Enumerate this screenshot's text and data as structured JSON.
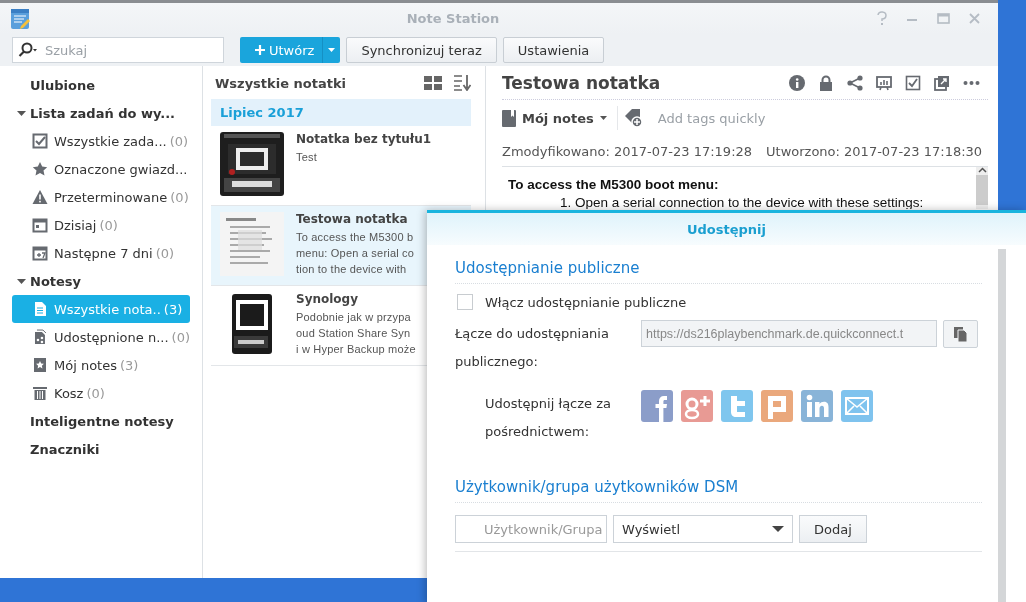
{
  "window": {
    "title": "Note Station"
  },
  "toolbar": {
    "search": {
      "placeholder": "Szukaj"
    },
    "create_button": "Utwórz",
    "buttons": [
      "Synchronizuj teraz",
      "Ustawienia"
    ]
  },
  "sidebar": {
    "sections": [
      {
        "label": "Ulubione"
      },
      {
        "label": "Lista zadań do wy...",
        "expanded": true,
        "children": [
          {
            "label": "Wszystkie zada...",
            "count": "(0)",
            "selected": false
          },
          {
            "label": "Oznaczone gwiazd...",
            "selected": false
          },
          {
            "label": "Przeterminowane",
            "count": "(0)",
            "selected": false
          },
          {
            "label": "Dzisiaj",
            "count": "(0)",
            "selected": false
          },
          {
            "label": "Następne 7 dni",
            "count": "(0)",
            "selected": false
          }
        ]
      },
      {
        "label": "Notesy",
        "expanded": true,
        "children": [
          {
            "label": "Wszystkie nota..",
            "count": "(3)",
            "selected": true
          },
          {
            "label": "Udostępnione n...",
            "count": "(0)",
            "selected": false
          },
          {
            "label": "Mój notes",
            "count": "(3)",
            "selected": false
          },
          {
            "label": "Kosz",
            "count": "(0)",
            "selected": false
          }
        ]
      },
      {
        "label": "Inteligentne notesy"
      },
      {
        "label": "Znaczniki"
      }
    ]
  },
  "note_list": {
    "title": "Wszystkie notatki",
    "group": "Lipiec 2017",
    "notes": [
      {
        "title": "Notatka bez tytułu1",
        "preview": [
          "Test"
        ],
        "selected": false
      },
      {
        "title": "Testowa notatka",
        "preview": [
          "To access the M5300 b",
          "menu: Open a serial co",
          "tion to the device with"
        ],
        "selected": true
      },
      {
        "title": "Synology",
        "preview": [
          "Podobnie jak w przypa",
          "oud Station Share Syn",
          "i w Hyper Backup może"
        ],
        "selected": false
      }
    ]
  },
  "detail": {
    "title": "Testowa notatka",
    "notebook": "Mój notes",
    "tags_placeholder": "Add tags quickly",
    "modified": "Zmodyfikowano: 2017-07-23 17:19:28",
    "created": "Utworzono: 2017-07-23 17:18:30",
    "body_heading": "To access the M5300 boot menu:",
    "body_item": "1. Open a serial connection to the device with these settings:"
  },
  "dialog": {
    "title": "Udostępnij",
    "public_section": "Udostępnianie publiczne",
    "enable_public": {
      "label": "Włącz udostępnianie publiczne",
      "checked": false
    },
    "link_label": "Łącze do udostępniania publicznego:",
    "link_value": "https://ds216playbenchmark.de.quickconnect.t",
    "share_label": "Udostępnij łącze za pośrednictwem:",
    "user_section": "Użytkownik/grupa użytkowników DSM",
    "user_field": {
      "placeholder": "Użytkownik/Grupa"
    },
    "permission": "Wyświetl",
    "add_button": "Dodaj"
  }
}
